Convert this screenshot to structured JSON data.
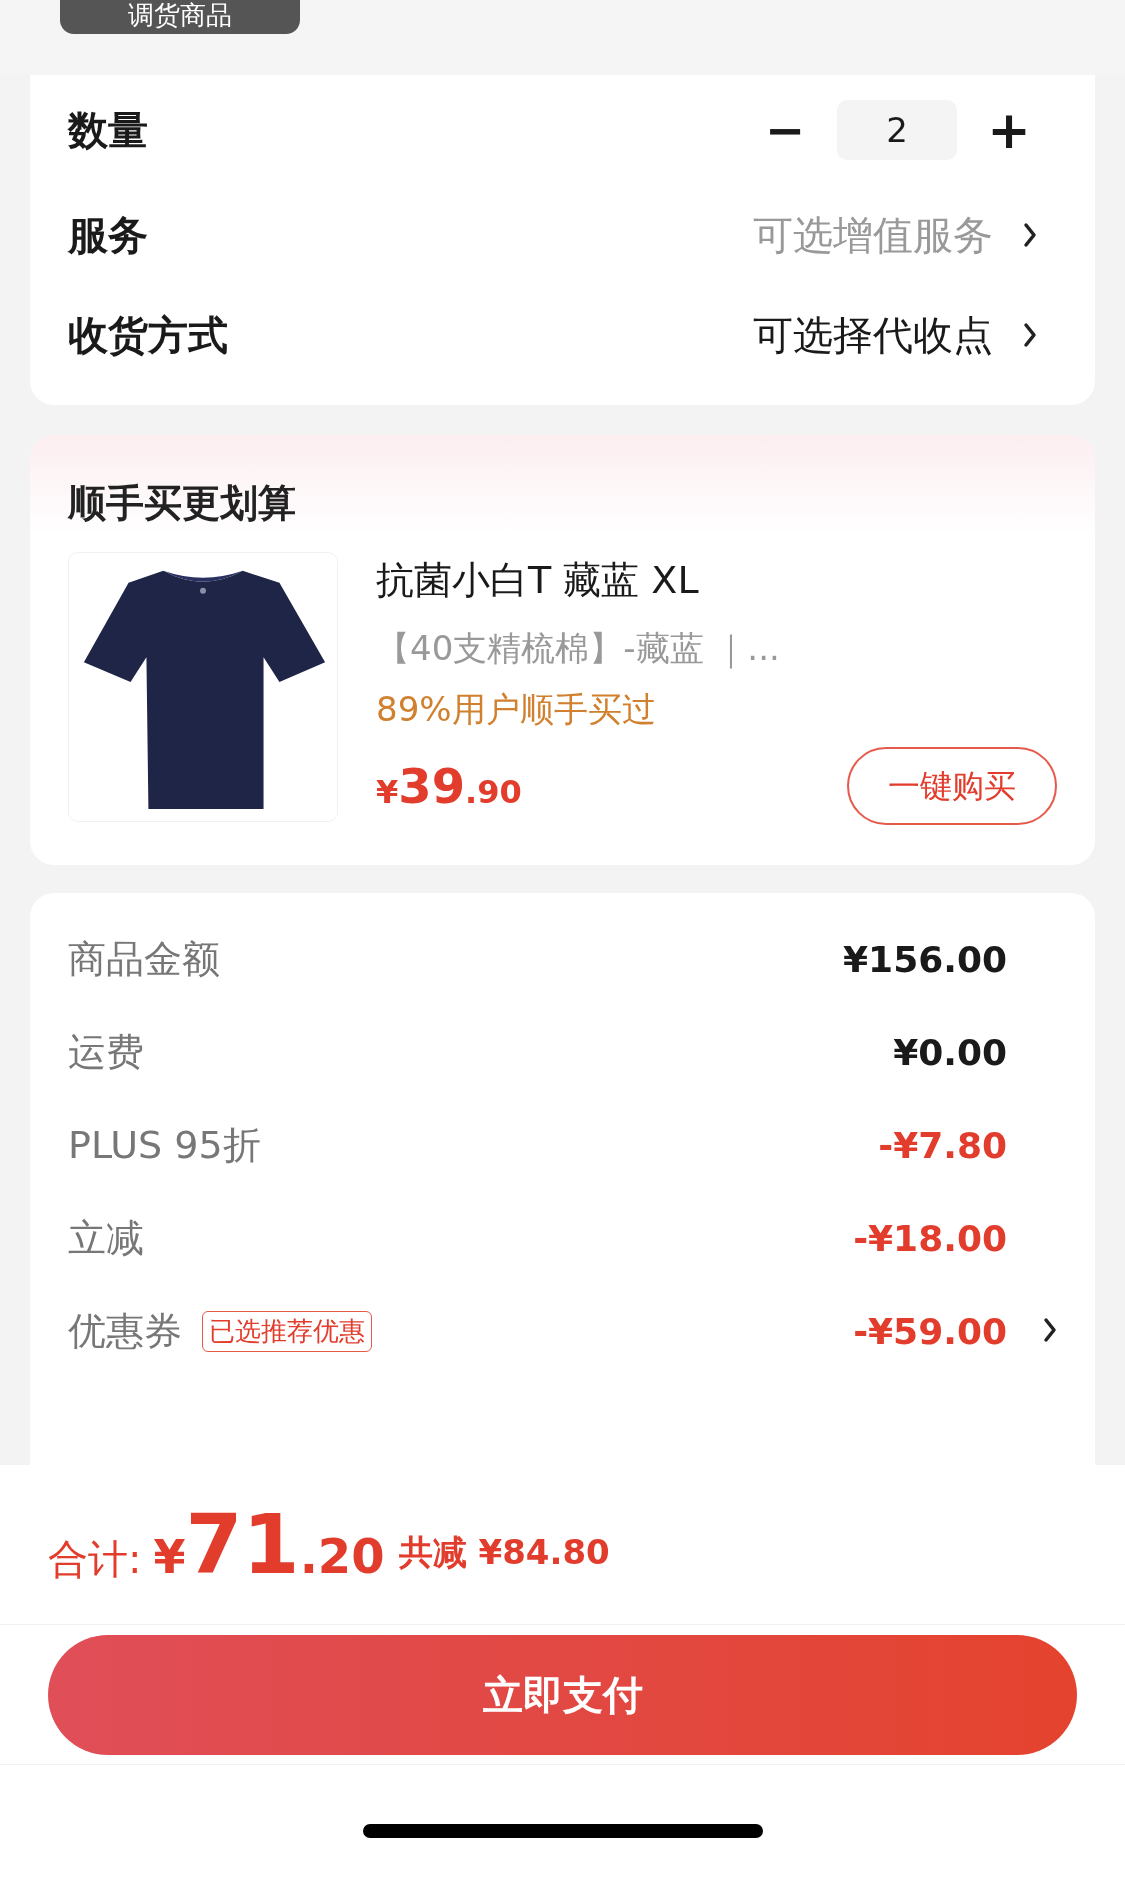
{
  "top_tag": "调货商品",
  "options": [
    {
      "kind": "stepper",
      "label": "数量",
      "value": "2",
      "minus": "−",
      "plus": "+"
    },
    {
      "kind": "link",
      "label": "服务",
      "value": "可选增值服务",
      "muted": true
    },
    {
      "kind": "link",
      "label": "收货方式",
      "value": "可选择代收点",
      "muted": false
    }
  ],
  "addon": {
    "title": "顺手买更划算",
    "product": {
      "name": "抗菌小白T 藏蓝 XL",
      "spec": "【40支精梳棉】-藏蓝 ｜...",
      "hint": "89%用户顺手买过",
      "currency": "¥",
      "price_int": "39",
      "price_dec": ".90",
      "button": "一键购买"
    }
  },
  "summary": [
    {
      "label": "商品金额",
      "amount": "¥156.00",
      "discount": false,
      "arrow": false
    },
    {
      "label": "运费",
      "amount": "¥0.00",
      "discount": false,
      "arrow": false
    },
    {
      "label": "PLUS 95折",
      "amount": "-¥7.80",
      "discount": true,
      "arrow": false
    },
    {
      "label": "立减",
      "amount": "-¥18.00",
      "discount": true,
      "arrow": false
    },
    {
      "label": "优惠券",
      "tag": "已选推荐优惠",
      "amount": "-¥59.00",
      "discount": true,
      "arrow": true
    }
  ],
  "total": {
    "label": "合计:",
    "currency": "¥",
    "int": "71",
    "dec": ".20",
    "saved_label": "共减",
    "saved": "¥84.80"
  },
  "pay_button": "立即支付"
}
